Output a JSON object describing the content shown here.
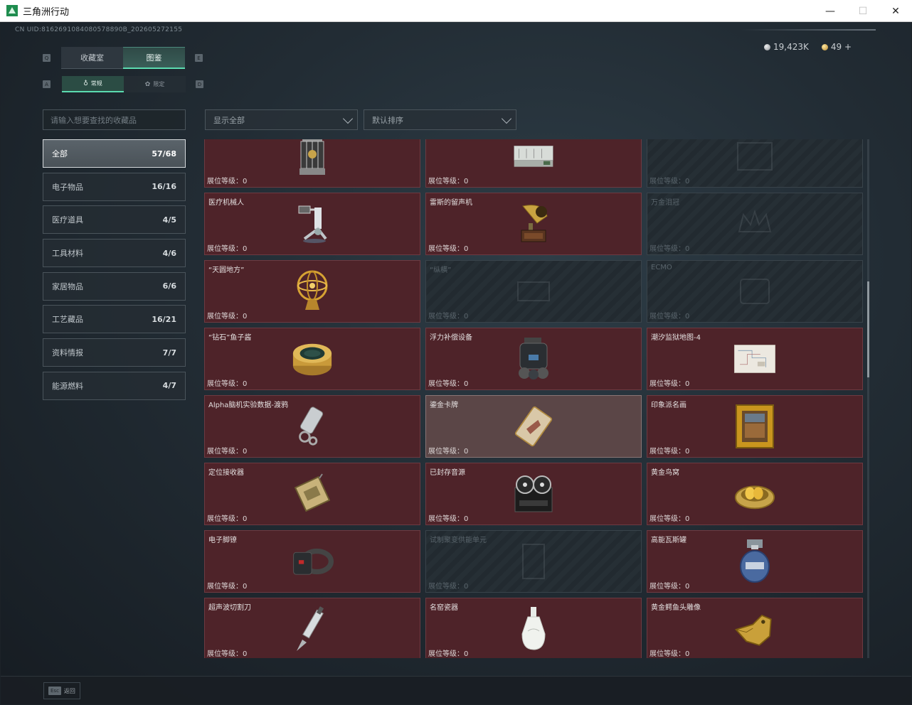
{
  "window": {
    "title": "三角洲行动"
  },
  "uid": "CN UID:8162691084080578890B_202605272155",
  "currency": {
    "silver": "19,423K",
    "gold": "49 +"
  },
  "main_tabs": [
    {
      "label": "收藏室",
      "active": false
    },
    {
      "label": "图鉴",
      "active": true
    }
  ],
  "sub_tabs": [
    {
      "label": "常规",
      "active": true
    },
    {
      "label": "限定",
      "active": false
    }
  ],
  "search": {
    "placeholder": "请输入想要查找的收藏品"
  },
  "filter": {
    "value": "显示全部"
  },
  "sort": {
    "value": "默认排序"
  },
  "categories": [
    {
      "label": "全部",
      "count": "57/68",
      "active": true
    },
    {
      "label": "电子物品",
      "count": "16/16"
    },
    {
      "label": "医疗道具",
      "count": "4/5"
    },
    {
      "label": "工具材料",
      "count": "4/6"
    },
    {
      "label": "家居物品",
      "count": "6/6"
    },
    {
      "label": "工艺藏品",
      "count": "16/21"
    },
    {
      "label": "资料情报",
      "count": "7/7"
    },
    {
      "label": "能源燃料",
      "count": "4/7"
    }
  ],
  "level_label": "展位等级：",
  "level_value": "0",
  "items": [
    {
      "name": "",
      "icon": "cage-device-icon",
      "locked": false
    },
    {
      "name": "",
      "icon": "server-case-icon",
      "locked": false
    },
    {
      "name": "",
      "icon": "unknown-icon",
      "locked": true
    },
    {
      "name": "医疗机械人",
      "icon": "medical-robot-icon",
      "locked": false
    },
    {
      "name": "雷斯的留声机",
      "icon": "gramophone-icon",
      "locked": false
    },
    {
      "name": "万金泪冠",
      "icon": "crown-icon",
      "locked": true
    },
    {
      "name": "“天圆地方”",
      "icon": "armillary-sphere-icon",
      "locked": false
    },
    {
      "name": "“纵横”",
      "icon": "device-icon",
      "locked": true
    },
    {
      "name": "ECMO",
      "icon": "ecmo-icon",
      "locked": true
    },
    {
      "name": "“钻石”鱼子酱",
      "icon": "caviar-tin-icon",
      "locked": false
    },
    {
      "name": "浮力补偿设备",
      "icon": "diving-gear-icon",
      "locked": false
    },
    {
      "name": "潮汐监狱地图-4",
      "icon": "map-icon",
      "locked": false
    },
    {
      "name": "Alpha脑机实验数据-渡鸦",
      "icon": "data-drive-icon",
      "locked": false
    },
    {
      "name": "鎏金卡牌",
      "icon": "card-icon",
      "locked": false,
      "highlight": true
    },
    {
      "name": "印象派名画",
      "icon": "painting-icon",
      "locked": false
    },
    {
      "name": "定位接收器",
      "icon": "receiver-icon",
      "locked": false
    },
    {
      "name": "已封存音源",
      "icon": "reel-recorder-icon",
      "locked": false
    },
    {
      "name": "黄金鸟窝",
      "icon": "golden-nest-icon",
      "locked": false
    },
    {
      "name": "电子脚镣",
      "icon": "ankle-monitor-icon",
      "locked": false
    },
    {
      "name": "试制聚变供能单元",
      "icon": "fusion-cell-icon",
      "locked": true
    },
    {
      "name": "高能瓦斯罐",
      "icon": "gas-canister-icon",
      "locked": false
    },
    {
      "name": "超声波切割刀",
      "icon": "scalpel-icon",
      "locked": false
    },
    {
      "name": "名窑瓷器",
      "icon": "porcelain-vase-icon",
      "locked": false
    },
    {
      "name": "黄金鳄鱼头雕像",
      "icon": "gold-crocodile-icon",
      "locked": false
    }
  ],
  "footer": {
    "key": "Esc",
    "label": "返回"
  },
  "colors": {
    "accent": "#5bdbb0",
    "card_owned": "#4e2329",
    "card_locked": "#232b31"
  }
}
